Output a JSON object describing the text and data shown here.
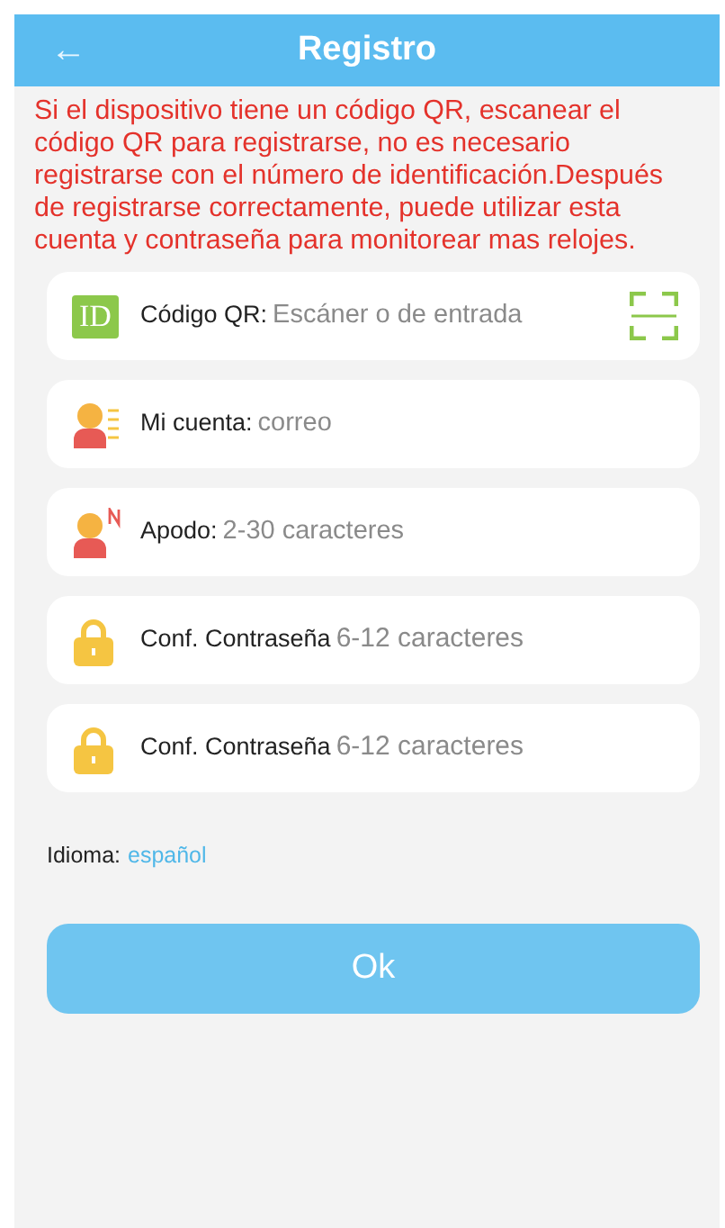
{
  "header": {
    "title": "Registro",
    "back": "←"
  },
  "notice": "Si el dispositivo tiene un código QR, escanear el código QR para registrarse, no es necesario registrarse con el número de identificación.Después de registrarse correctamente, puede utilizar esta cuenta y contraseña para monitorear mas relojes.",
  "fields": [
    {
      "kind": "qr",
      "badge": "ID",
      "label": "Código QR:",
      "placeholder": "Escáner o de entrada"
    },
    {
      "kind": "account",
      "label": "Mi cuenta:",
      "placeholder": "correo"
    },
    {
      "kind": "nickname",
      "label": "Apodo:",
      "placeholder": "2-30 caracteres"
    },
    {
      "kind": "password",
      "label": "Conf. Contraseña",
      "placeholder": "6-12 caracteres"
    },
    {
      "kind": "password",
      "label": "Conf. Contraseña",
      "placeholder": "6-12 caracteres"
    }
  ],
  "language": {
    "label": "Idioma:",
    "value": "español"
  },
  "submit": "Ok"
}
